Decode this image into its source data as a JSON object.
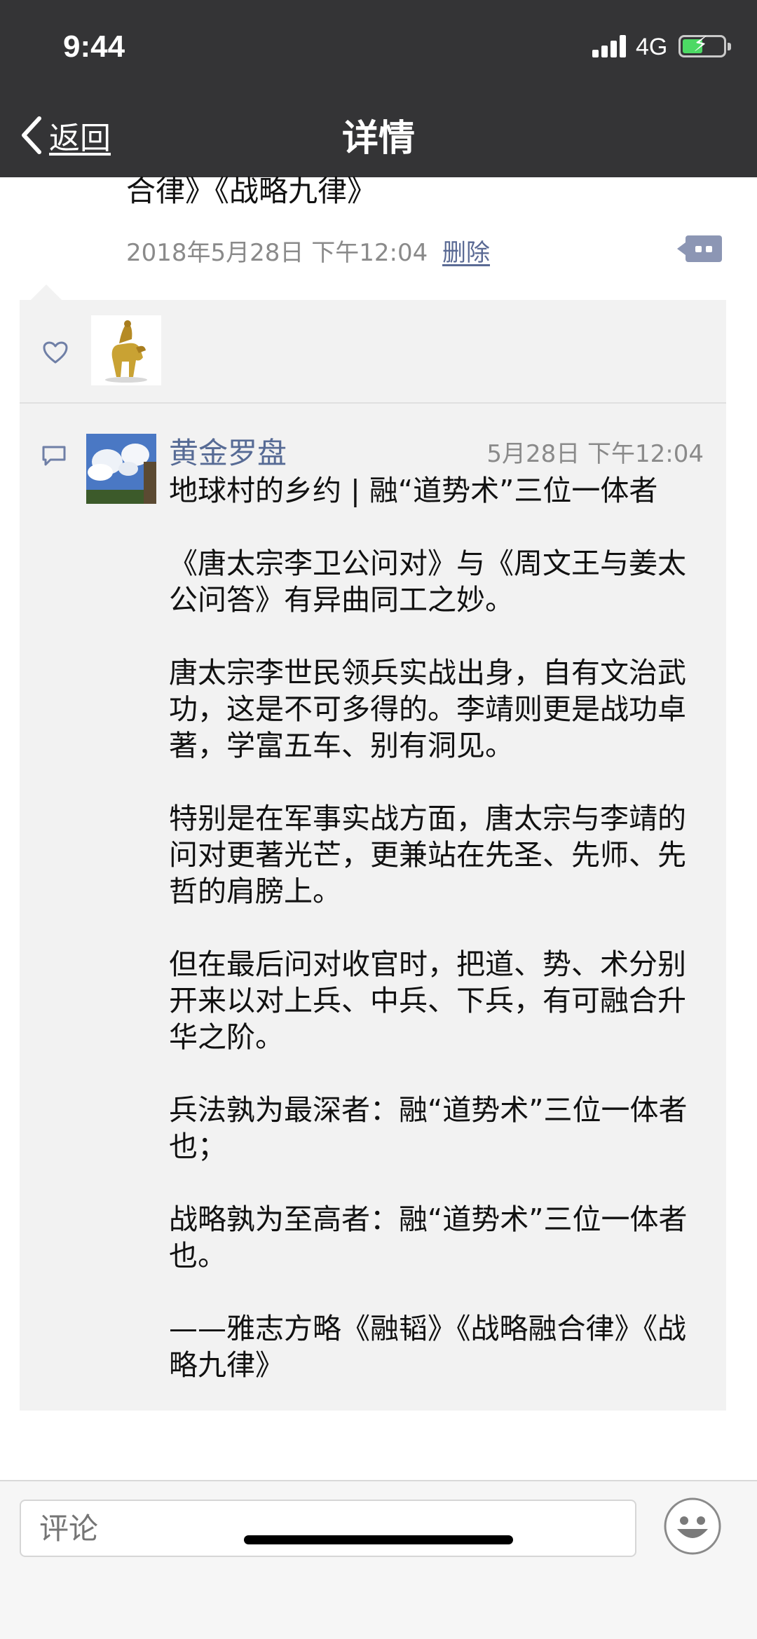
{
  "status_bar": {
    "time": "9:44",
    "network": "4G"
  },
  "nav": {
    "back_label": "返回",
    "title": "详情"
  },
  "post": {
    "text_tail": "合律》《战略九律》",
    "time": "2018年5月28日 下午12:04",
    "delete_label": "删除"
  },
  "likes": {
    "icon": "heart-icon"
  },
  "comment": {
    "author": "黄金罗盘",
    "time": "5月28日 下午12:04",
    "paragraphs": [
      "地球村的乡约 | 融“道势术”三位一体者",
      "",
      "《唐太宗李卫公问对》与《周文王与姜太公问答》有异曲同工之妙。",
      "",
      "唐太宗李世民领兵实战出身，自有文治武功，这是不可多得的。李靖则更是战功卓著，学富五车、别有洞见。",
      "",
      "特别是在军事实战方面，唐太宗与李靖的问对更著光芒，更兼站在先圣、先师、先哲的肩膀上。",
      "",
      "但在最后问对收官时，把道、势、术分别开来以对上兵、中兵、下兵，有可融合升华之阶。",
      "",
      "兵法孰为最深者：融“道势术”三位一体者也；",
      "",
      "战略孰为至高者：融“道势术”三位一体者也。",
      "",
      "——雅志方略《融韬》《战略融合律》《战略九律》"
    ]
  },
  "input": {
    "placeholder": "评论"
  },
  "colors": {
    "header_bg": "#343436",
    "link": "#576b95",
    "panel_bg": "#f2f2f2"
  }
}
